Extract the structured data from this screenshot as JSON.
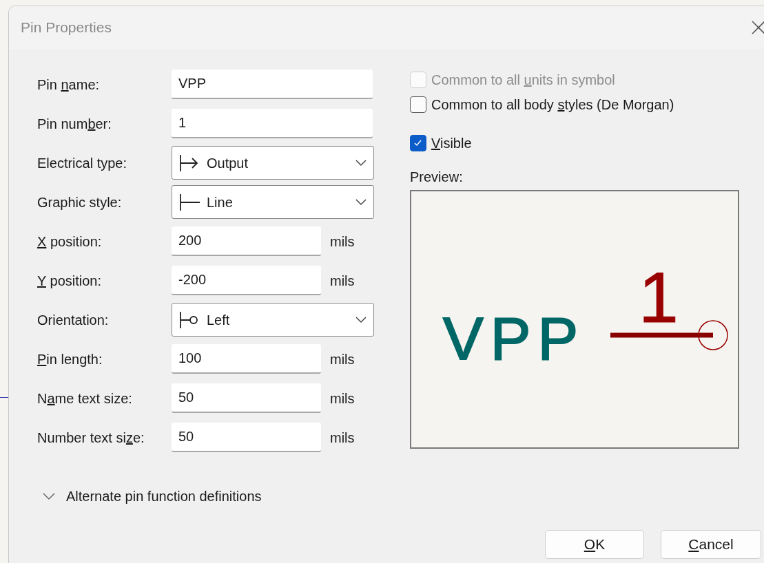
{
  "window": {
    "title": "Pin Properties"
  },
  "fields": [
    {
      "kind": "text",
      "label": {
        "before": "Pin ",
        "key": "n",
        "after": "ame:"
      },
      "value": "VPP"
    },
    {
      "kind": "text",
      "label": {
        "before": "Pin num",
        "key": "b",
        "after": "er:"
      },
      "value": "1"
    },
    {
      "kind": "select",
      "label": {
        "before": "Electrical type:"
      },
      "value": "Output"
    },
    {
      "kind": "select",
      "label": {
        "before": "Graphic style:"
      },
      "value": "Line"
    },
    {
      "kind": "unit",
      "label": {
        "key": "X",
        "after": " position:"
      },
      "value": "200",
      "unit": "mils"
    },
    {
      "kind": "unit",
      "label": {
        "key": "Y",
        "after": " position:"
      },
      "value": "-200",
      "unit": "mils"
    },
    {
      "kind": "select",
      "label": {
        "before": "Orientation:"
      },
      "value": "Left"
    },
    {
      "kind": "unit",
      "label": {
        "key": "P",
        "after": "in length:"
      },
      "value": "100",
      "unit": "mils"
    },
    {
      "kind": "unit",
      "label": {
        "before": "N",
        "key": "a",
        "after": "me text size:"
      },
      "value": "50",
      "unit": "mils"
    },
    {
      "kind": "unit",
      "label": {
        "before": "Number text si",
        "key": "z",
        "after": "e:"
      },
      "value": "50",
      "unit": "mils"
    }
  ],
  "options": [
    {
      "label": {
        "before": "Common to all ",
        "key": "u",
        "after": "nits in symbol"
      },
      "checked": false,
      "disabled": true
    },
    {
      "label": {
        "before": "Common to all body ",
        "key": "s",
        "after": "tyles (De Morgan)"
      },
      "checked": false,
      "disabled": false
    },
    {
      "label": {
        "key": "V",
        "after": "isible"
      },
      "checked": true,
      "disabled": false
    }
  ],
  "preview": {
    "label": "Preview:",
    "pin_name": "VPP",
    "pin_number": "1"
  },
  "alternates": {
    "label": "Alternate pin function definitions",
    "expanded": false
  },
  "buttons": [
    {
      "label": {
        "key": "O",
        "after": "K"
      }
    },
    {
      "label": {
        "key": "C",
        "after": "ancel"
      }
    }
  ]
}
